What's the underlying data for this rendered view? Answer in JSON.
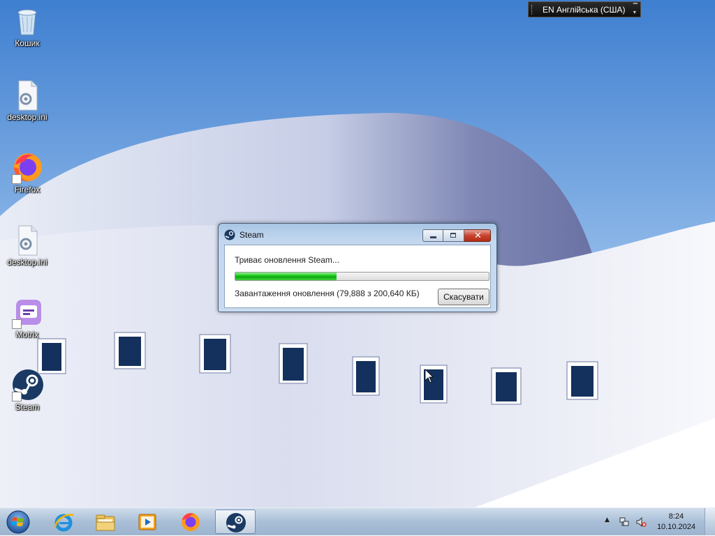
{
  "colors": {
    "accent": "#2a5db0",
    "progress": "#16c516",
    "taskbar": "#a9bfd7"
  },
  "desktop": {
    "icons": [
      {
        "label": "Кошик",
        "icon": "recycle-bin-icon"
      },
      {
        "label": "desktop.ini",
        "icon": "settings-file-icon"
      },
      {
        "label": "Firefox",
        "icon": "firefox-icon"
      },
      {
        "label": "desktop.ini",
        "icon": "settings-file-icon"
      },
      {
        "label": "Motrix",
        "icon": "motrix-icon"
      },
      {
        "label": "Steam",
        "icon": "steam-icon"
      }
    ]
  },
  "language_bar": {
    "text": "EN Англійська (США)"
  },
  "dialog": {
    "title": "Steam",
    "status": "Триває оновлення Steam...",
    "progress": 0.4,
    "detail": "Завантаження оновлення (79,888 з 200,640 КБ)",
    "cancel_label": "Скасувати"
  },
  "taskbar": {
    "pinned": [
      "internet-explorer-icon",
      "file-explorer-icon",
      "media-player-icon",
      "firefox-icon",
      "steam-icon"
    ],
    "clock_time": "8:24",
    "clock_date": "10.10.2024"
  }
}
